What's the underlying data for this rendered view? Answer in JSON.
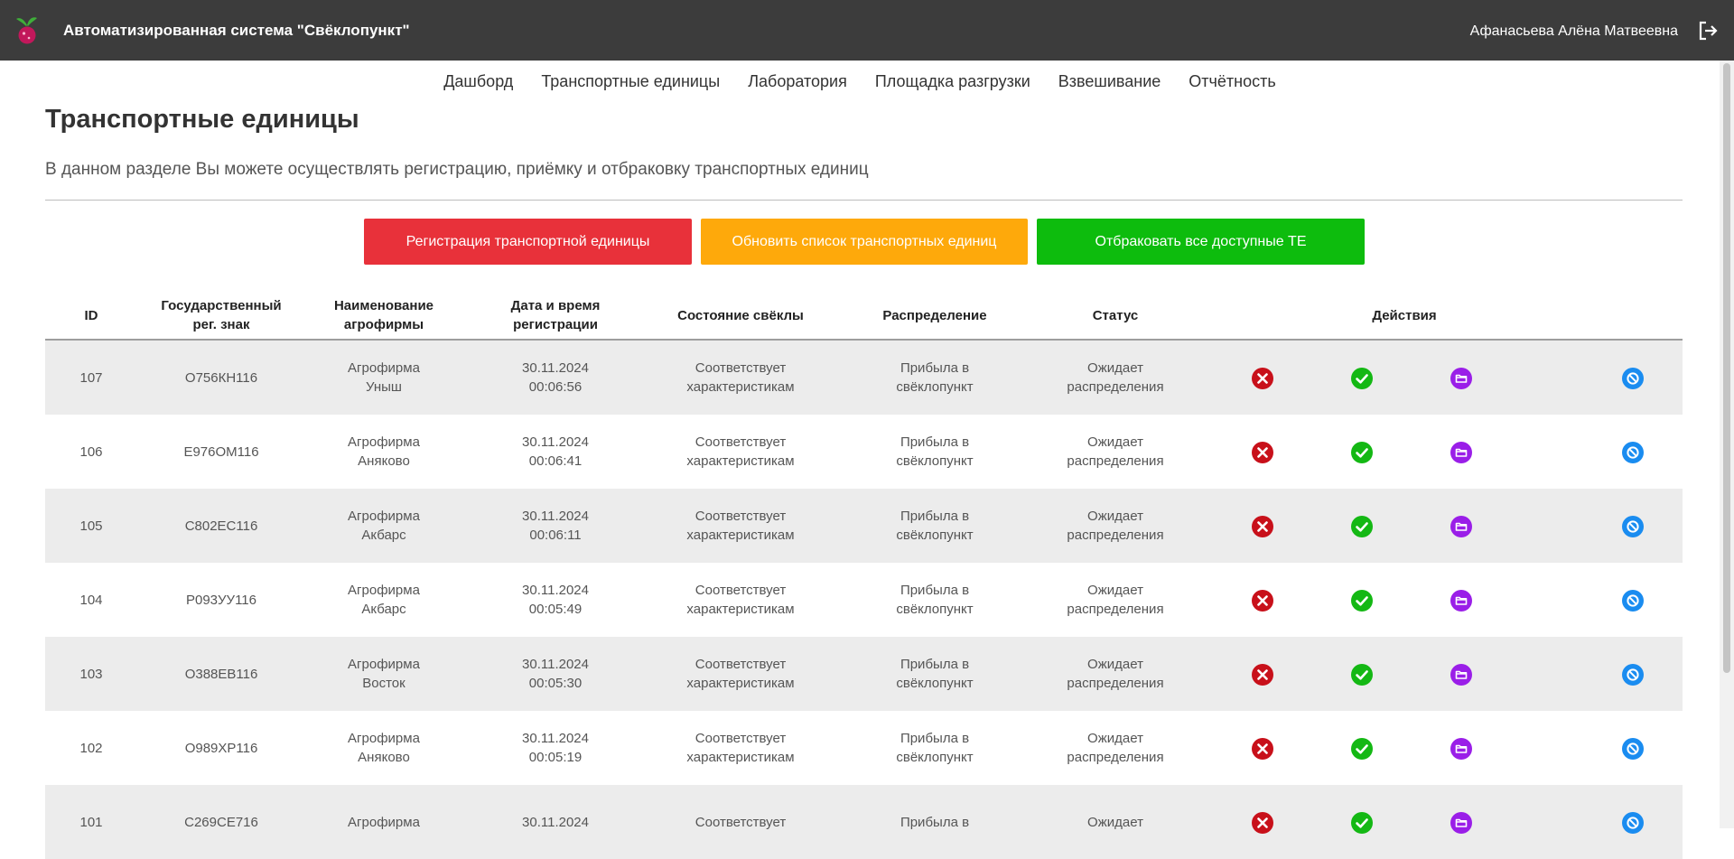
{
  "header": {
    "app_title": "Автоматизированная система \"Свёклопункт\"",
    "user_name": "Афанасьева Алёна Матвеевна",
    "icons": [
      "beet-logo-icon",
      "logout-icon"
    ]
  },
  "nav": {
    "items": [
      {
        "label": "Дашборд"
      },
      {
        "label": "Транспортные единицы"
      },
      {
        "label": "Лаборатория"
      },
      {
        "label": "Площадка разгрузки"
      },
      {
        "label": "Взвешивание"
      },
      {
        "label": "Отчётность"
      }
    ]
  },
  "page": {
    "title": "Транспортные единицы",
    "subtitle": "В данном разделе Вы можете осуществлять регистрацию, приёмку и отбраковку транспортных единиц"
  },
  "buttons": {
    "register": "Регистрация транспортной единицы",
    "refresh": "Обновить список транспортных единиц",
    "reject_all": "Отбраковать все доступные ТЕ"
  },
  "colors": {
    "header_bg": "#3c3c3c",
    "register": "#e8313a",
    "refresh": "#fea90b",
    "reject_all": "#0dbc0d",
    "reject_icon": "#c8101a",
    "accept_icon": "#14b814",
    "details_icon": "#9a1ee8",
    "block_icon": "#1a8cf0"
  },
  "table": {
    "headers": {
      "id": "ID",
      "plate_1": "Государственный",
      "plate_2": "рег. знак",
      "farm_1": "Наименование",
      "farm_2": "агрофирмы",
      "date_1": "Дата и время",
      "date_2": "регистрации",
      "state": "Состояние свёклы",
      "distribution": "Распределение",
      "status": "Статус",
      "actions": "Действия"
    },
    "action_icons": [
      "reject-icon",
      "accept-icon",
      "details-icon",
      "block-icon"
    ],
    "rows": [
      {
        "id": "107",
        "plate": "О756КН116",
        "farm_1": "Агрофирма",
        "farm_2": "Уныш",
        "date": "30.11.2024",
        "time": "00:06:56",
        "state_1": "Соответствует",
        "state_2": "характеристикам",
        "dist_1": "Прибыла в",
        "dist_2": "свёклопункт",
        "status_1": "Ожидает",
        "status_2": "распределения"
      },
      {
        "id": "106",
        "plate": "Е976ОМ116",
        "farm_1": "Агрофирма",
        "farm_2": "Аняково",
        "date": "30.11.2024",
        "time": "00:06:41",
        "state_1": "Соответствует",
        "state_2": "характеристикам",
        "dist_1": "Прибыла в",
        "dist_2": "свёклопункт",
        "status_1": "Ожидает",
        "status_2": "распределения"
      },
      {
        "id": "105",
        "plate": "С802ЕС116",
        "farm_1": "Агрофирма",
        "farm_2": "Акбарс",
        "date": "30.11.2024",
        "time": "00:06:11",
        "state_1": "Соответствует",
        "state_2": "характеристикам",
        "dist_1": "Прибыла в",
        "dist_2": "свёклопункт",
        "status_1": "Ожидает",
        "status_2": "распределения"
      },
      {
        "id": "104",
        "plate": "Р093УУ116",
        "farm_1": "Агрофирма",
        "farm_2": "Акбарс",
        "date": "30.11.2024",
        "time": "00:05:49",
        "state_1": "Соответствует",
        "state_2": "характеристикам",
        "dist_1": "Прибыла в",
        "dist_2": "свёклопункт",
        "status_1": "Ожидает",
        "status_2": "распределения"
      },
      {
        "id": "103",
        "plate": "О388ЕВ116",
        "farm_1": "Агрофирма",
        "farm_2": "Восток",
        "date": "30.11.2024",
        "time": "00:05:30",
        "state_1": "Соответствует",
        "state_2": "характеристикам",
        "dist_1": "Прибыла в",
        "dist_2": "свёклопункт",
        "status_1": "Ожидает",
        "status_2": "распределения"
      },
      {
        "id": "102",
        "plate": "О989ХР116",
        "farm_1": "Агрофирма",
        "farm_2": "Аняково",
        "date": "30.11.2024",
        "time": "00:05:19",
        "state_1": "Соответствует",
        "state_2": "характеристикам",
        "dist_1": "Прибыла в",
        "dist_2": "свёклопункт",
        "status_1": "Ожидает",
        "status_2": "распределения"
      },
      {
        "id": "101",
        "plate": "С269СЕ716",
        "farm_1": "Агрофирма",
        "farm_2": "",
        "date": "30.11.2024",
        "time": "",
        "state_1": "Соответствует",
        "state_2": "",
        "dist_1": "Прибыла в",
        "dist_2": "",
        "status_1": "Ожидает",
        "status_2": ""
      }
    ]
  }
}
